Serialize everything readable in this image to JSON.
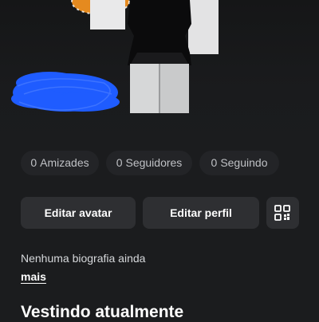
{
  "stats": {
    "friends": {
      "count": "0",
      "label": "Amizades"
    },
    "followers": {
      "count": "0",
      "label": "Seguidores"
    },
    "following": {
      "count": "0",
      "label": "Seguindo"
    }
  },
  "actions": {
    "edit_avatar": "Editar avatar",
    "edit_profile": "Editar perfil",
    "qr_icon": "qr-code-icon"
  },
  "bio": {
    "text": "Nenhuma biografia ainda",
    "more_label": "mais"
  },
  "section": {
    "wearing_title": "Vestindo atualmente"
  },
  "colors": {
    "background": "#1b1c1e",
    "chip_bg": "#232427",
    "button_bg": "#2e2f32",
    "scribble": "#1f5cff"
  }
}
